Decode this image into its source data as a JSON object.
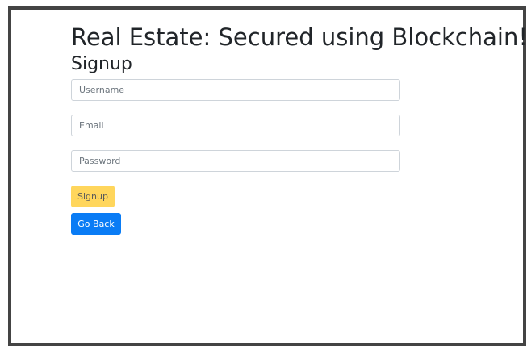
{
  "page": {
    "title": "Real Estate: Secured using Blockchain!",
    "subtitle": "Signup"
  },
  "form": {
    "username_placeholder": "Username",
    "email_placeholder": "Email",
    "password_placeholder": "Password",
    "signup_label": "Signup",
    "back_label": "Go Back"
  },
  "colors": {
    "signup_button": "#ffd65c",
    "back_button": "#0a7cf5",
    "border": "#444444"
  }
}
